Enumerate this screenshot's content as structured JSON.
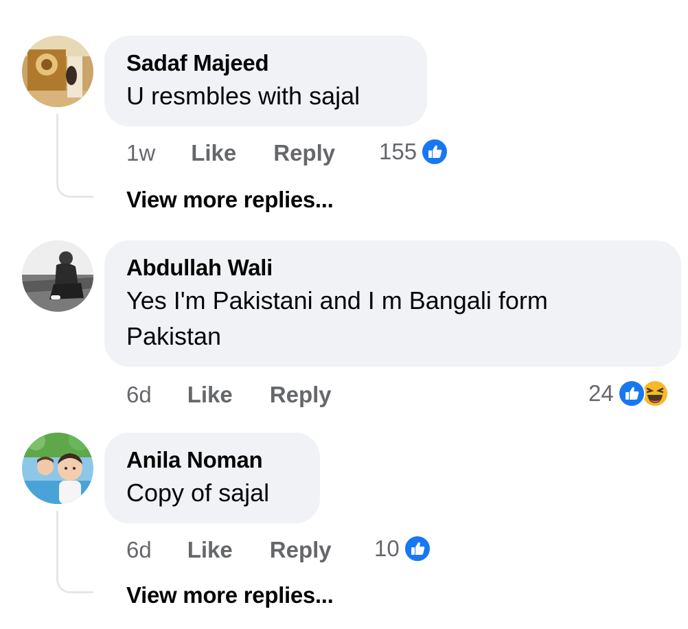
{
  "comments": [
    {
      "author": "Sadaf Majeed",
      "text_lines": [
        "U resmbles with sajal"
      ],
      "time": "1w",
      "like_label": "Like",
      "reply_label": "Reply",
      "reaction_count": "155",
      "reactions": [
        "like-icon"
      ],
      "view_more": "View more replies..."
    },
    {
      "author": "Abdullah Wali",
      "text_lines": [
        "Yes I'm Pakistani and I m Bangali form",
        "Pakistan"
      ],
      "time": "6d",
      "like_label": "Like",
      "reply_label": "Reply",
      "reaction_count": "24",
      "reactions": [
        "like-icon",
        "haha-icon"
      ]
    },
    {
      "author": "Anila Noman",
      "text_lines": [
        "Copy of sajal"
      ],
      "time": "6d",
      "like_label": "Like",
      "reply_label": "Reply",
      "reaction_count": "10",
      "reactions": [
        "like-icon"
      ],
      "view_more": "View more replies..."
    }
  ],
  "colors": {
    "bubble_bg": "#f0f2f5",
    "secondary_text": "#65676b",
    "like_blue": "#1877f2",
    "haha_yellow": "#f7b928"
  }
}
